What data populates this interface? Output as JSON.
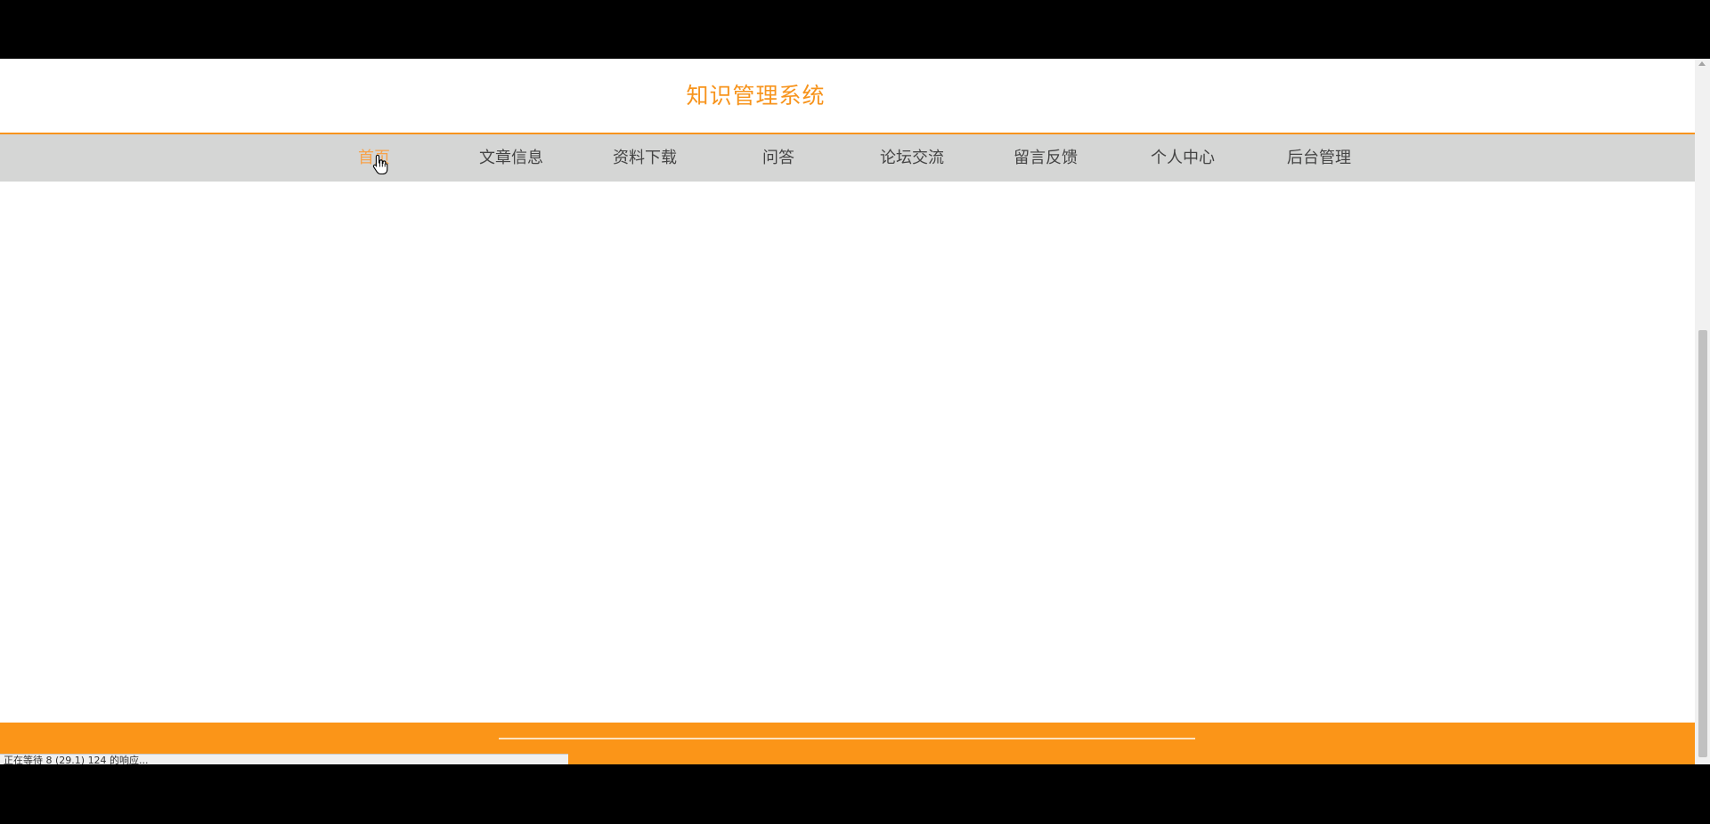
{
  "header": {
    "site_title": "知识管理系统"
  },
  "nav": {
    "items": [
      {
        "label": "首页",
        "active": true
      },
      {
        "label": "文章信息",
        "active": false
      },
      {
        "label": "资料下载",
        "active": false
      },
      {
        "label": "问答",
        "active": false
      },
      {
        "label": "论坛交流",
        "active": false
      },
      {
        "label": "留言反馈",
        "active": false
      },
      {
        "label": "个人中心",
        "active": false
      },
      {
        "label": "后台管理",
        "active": false
      }
    ]
  },
  "status_bar": {
    "text": "正在等待 8 (29.1) 124 的响应..."
  },
  "colors": {
    "accent": "#f7941d",
    "nav_background": "#d5d6d5",
    "footer_background": "#fb9518"
  },
  "icons": {
    "cursor": "hand-pointer-icon",
    "scroll_up": "arrow-up-icon"
  }
}
